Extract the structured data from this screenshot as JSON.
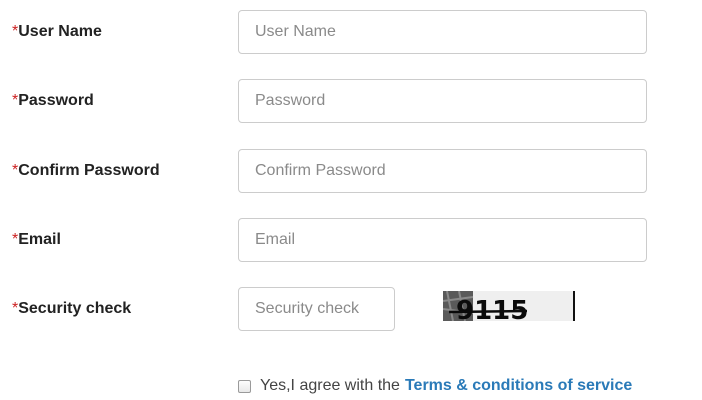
{
  "form": {
    "required_marker": "*",
    "fields": [
      {
        "label": "User Name",
        "placeholder": "User Name",
        "value": ""
      },
      {
        "label": "Password",
        "placeholder": "Password",
        "value": ""
      },
      {
        "label": "Confirm Password",
        "placeholder": "Confirm Password",
        "value": ""
      },
      {
        "label": "Email",
        "placeholder": "Email",
        "value": ""
      },
      {
        "label": "Security check",
        "placeholder": "Security check",
        "value": ""
      }
    ],
    "captcha": {
      "text": "9115"
    },
    "agreement": {
      "checked": false,
      "text": "Yes,I agree with the",
      "link_text": "Terms & conditions of service"
    }
  },
  "colors": {
    "required": "#cc2222",
    "link": "#2a7ab8",
    "input_border": "#cccccc",
    "placeholder": "#8a8a8a"
  }
}
